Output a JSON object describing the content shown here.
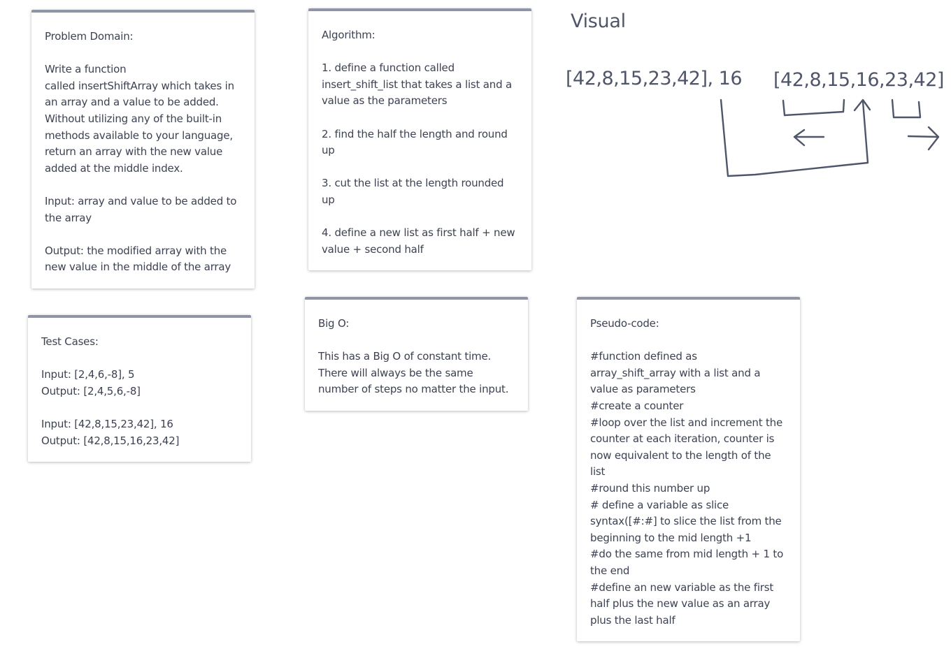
{
  "cards": {
    "problem_domain": {
      "lines": [
        "Problem Domain:",
        "",
        "Write a function",
        "called insertShiftArray which takes in",
        "an array and a value to be added.",
        "Without utilizing any of the built-in",
        "methods available to your language,",
        "return an array with the new value",
        "added at the middle index.",
        "",
        "Input: array and value to be added to",
        "the array",
        "",
        "Output: the modified array with the",
        "new value in the middle of the array"
      ]
    },
    "algorithm": {
      "lines": [
        "Algorithm:",
        "",
        "1. define a function called",
        "insert_shift_list that takes a list and a",
        "value as the parameters",
        "",
        "2. find the half the length and round",
        "up",
        "",
        "3. cut the list at the length rounded",
        "up",
        "",
        "4. define a new list as first half + new",
        "value + second half"
      ]
    },
    "test_cases": {
      "lines": [
        "Test Cases:",
        "",
        "Input: [2,4,6,-8], 5",
        "Output: [2,4,5,6,-8]",
        "",
        "Input: [42,8,15,23,42], 16",
        "Output: [42,8,15,16,23,42]"
      ]
    },
    "big_o": {
      "lines": [
        "Big O:",
        "",
        "This has a Big O of constant time.",
        "There will always be the same",
        "number of steps no matter the input."
      ]
    },
    "pseudo_code": {
      "lines": [
        "Pseudo-code:",
        "",
        "#function defined as",
        "array_shift_array with a list and a",
        "value as parameters",
        "#create a counter",
        "#loop over the list and increment the",
        "counter at each iteration, counter is",
        "now equivalent to the length of the",
        "list",
        "#round this number up",
        "# define a variable as slice",
        "syntax([#:#] to slice the list from the",
        "beginning to the mid length +1",
        "#do the same from mid length + 1 to",
        "the end",
        "#define an new variable as the first",
        "half plus the new value as an array",
        "plus the last half"
      ]
    }
  },
  "visual": {
    "title": "Visual",
    "input_label": "[42,8,15,23,42], 16",
    "output_label": "[42,8,15,16,23,42]"
  },
  "colors": {
    "card_border": "#8f95a6",
    "text": "#3c4252",
    "sketch": "#50566a"
  }
}
